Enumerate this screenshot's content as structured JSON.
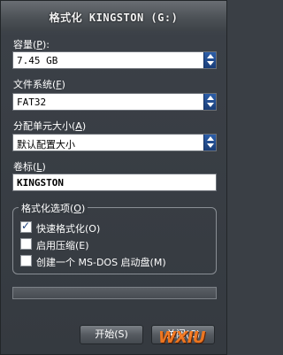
{
  "window": {
    "title": "格式化 KINGSTON (G:)"
  },
  "capacity": {
    "label": "容量",
    "accel": "P",
    "value": "7.45 GB"
  },
  "filesystem": {
    "label": "文件系统",
    "accel": "F",
    "value": "FAT32"
  },
  "allocation": {
    "label": "分配单元大小",
    "accel": "A",
    "value": "默认配置大小"
  },
  "volume": {
    "label": "卷标",
    "accel": "L",
    "value": "KINGSTON"
  },
  "options": {
    "label": "格式化选项",
    "accel": "O",
    "items": [
      {
        "label": "快速格式化(O)",
        "checked": true
      },
      {
        "label": "启用压缩(E)",
        "checked": false
      },
      {
        "label": "创建一个 MS-DOS 启动盘(M)",
        "checked": false
      }
    ]
  },
  "progress": {
    "value": 0
  },
  "buttons": {
    "start": "开始(S)",
    "close": "关闭(C)"
  },
  "watermark": "WXIU",
  "colors": {
    "accent": "#2d5ea8",
    "window_bg": "#3b4047",
    "watermark": "#ff7a1a"
  }
}
